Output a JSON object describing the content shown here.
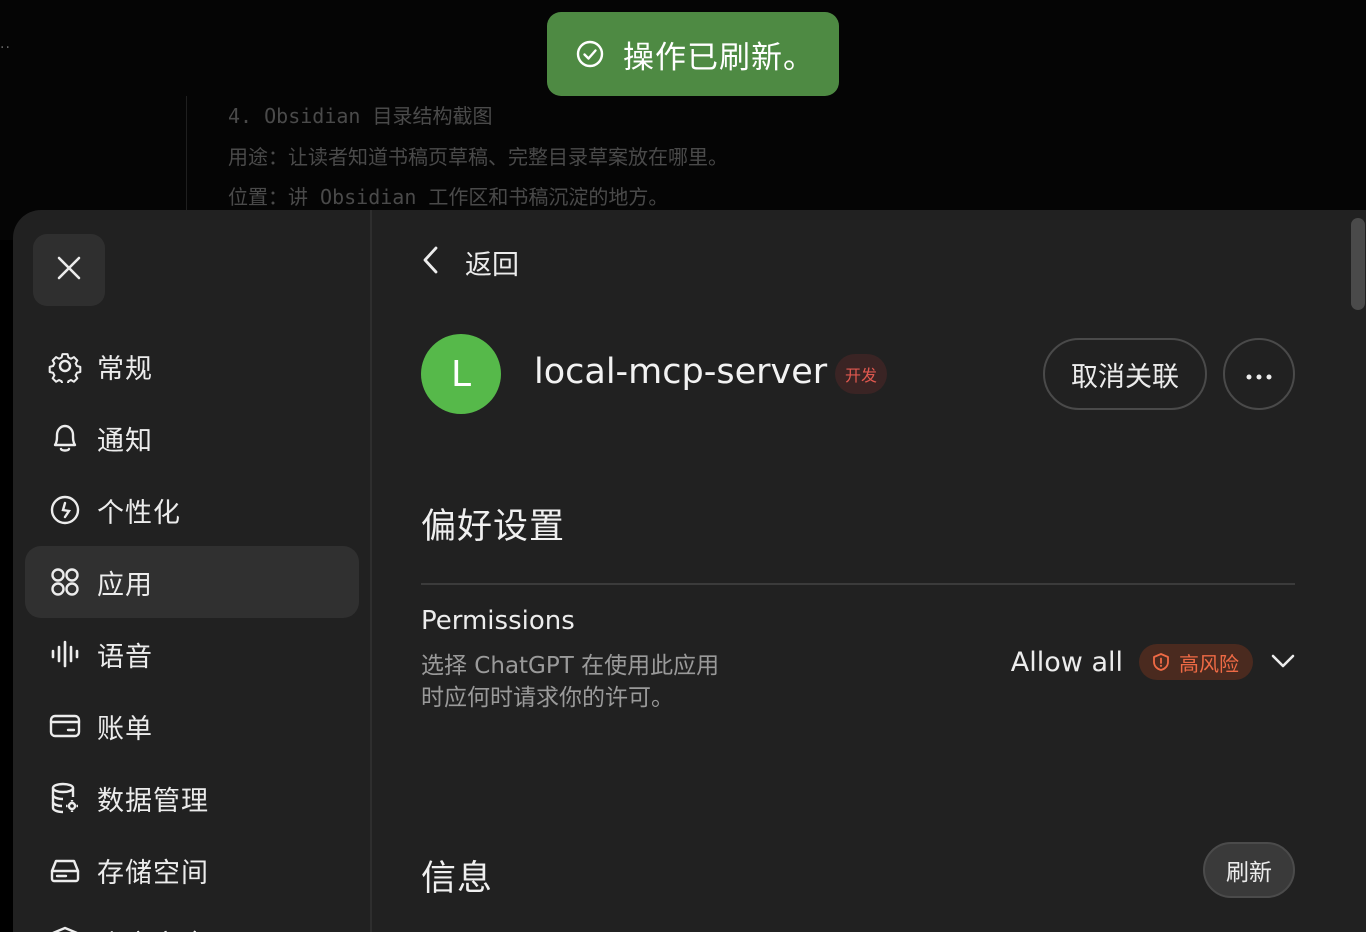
{
  "background": {
    "dots": "··",
    "lines": [
      "4. Obsidian 目录结构截图",
      "用途：让读者知道书稿页草稿、完整目录草案放在哪里。",
      "位置：讲 Obsidian 工作区和书稿沉淀的地方。"
    ]
  },
  "toast": {
    "text": "操作已刷新。",
    "icon": "check-circle-icon",
    "color": "#4e8a43"
  },
  "sidebar": {
    "close_icon": "close-icon",
    "items": [
      {
        "label": "常规",
        "icon": "gear-icon"
      },
      {
        "label": "通知",
        "icon": "bell-icon"
      },
      {
        "label": "个性化",
        "icon": "personalization-icon"
      },
      {
        "label": "应用",
        "icon": "apps-icon",
        "active": true
      },
      {
        "label": "语音",
        "icon": "voice-wave-icon"
      },
      {
        "label": "账单",
        "icon": "card-icon"
      },
      {
        "label": "数据管理",
        "icon": "database-gear-icon"
      },
      {
        "label": "存储空间",
        "icon": "storage-icon"
      },
      {
        "label": "账户安全",
        "icon": "shield-icon"
      }
    ]
  },
  "content": {
    "back_label": "返回",
    "app": {
      "avatar_letter": "L",
      "avatar_color": "#56b94a",
      "name": "local-mcp-server",
      "badge": "开发",
      "unlink_label": "取消关联",
      "more_icon": "ellipsis-icon"
    },
    "preferences_title": "偏好设置",
    "permissions": {
      "title": "Permissions",
      "description": "选择 ChatGPT 在使用此应用时应何时请求你的许可。",
      "value": "Allow all",
      "risk_label": "高风险",
      "risk_color": "#ef6a45"
    },
    "info_title": "信息",
    "refresh_label": "刷新"
  }
}
